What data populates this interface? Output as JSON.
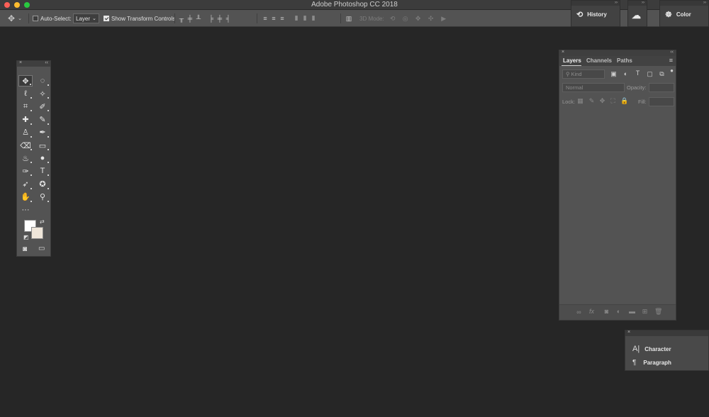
{
  "app": {
    "title": "Adobe Photoshop CC 2018"
  },
  "window": {
    "close_color": "#fd5f57",
    "minimize_color": "#febc2e",
    "zoom_color": "#29c840"
  },
  "options": {
    "move_icon": "move-tool-icon",
    "auto_select_label": "Auto-Select:",
    "auto_select_checked": false,
    "layer_select_value": "Layer",
    "show_transform_label": "Show Transform Controls",
    "show_transform_checked": true,
    "mode_3d_label": "3D Mode:"
  },
  "collapsed_panels": {
    "history": {
      "label": "History",
      "icon": "history-icon"
    },
    "libraries": {
      "icon": "creative-cloud-libraries-icon"
    },
    "color": {
      "label": "Color",
      "icon": "color-palette-icon"
    }
  },
  "tools": [
    {
      "name": "move-tool",
      "glyph": "✥",
      "active": true
    },
    {
      "name": "marquee-tool",
      "glyph": "◌"
    },
    {
      "name": "lasso-tool",
      "glyph": "ℓ"
    },
    {
      "name": "magic-wand-tool",
      "glyph": "✧"
    },
    {
      "name": "crop-tool",
      "glyph": "⌗"
    },
    {
      "name": "eyedropper-tool",
      "glyph": "✐"
    },
    {
      "name": "healing-brush-tool",
      "glyph": "✚"
    },
    {
      "name": "brush-tool",
      "glyph": "✎"
    },
    {
      "name": "clone-stamp-tool",
      "glyph": "♙"
    },
    {
      "name": "history-brush-tool",
      "glyph": "✒"
    },
    {
      "name": "eraser-tool",
      "glyph": "⌫"
    },
    {
      "name": "gradient-tool",
      "glyph": "▭"
    },
    {
      "name": "blur-tool",
      "glyph": "♨"
    },
    {
      "name": "dodge-tool",
      "glyph": "●"
    },
    {
      "name": "pen-tool",
      "glyph": "✑"
    },
    {
      "name": "type-tool",
      "glyph": "T"
    },
    {
      "name": "path-selection-tool",
      "glyph": "➶"
    },
    {
      "name": "custom-shape-tool",
      "glyph": "✪"
    },
    {
      "name": "hand-tool",
      "glyph": "✋"
    },
    {
      "name": "zoom-tool",
      "glyph": "⚲"
    },
    {
      "name": "edit-toolbar",
      "glyph": "···"
    }
  ],
  "colors": {
    "foreground": "#ffffff",
    "background": "#efe6da"
  },
  "layers_panel": {
    "tabs": [
      "Layers",
      "Channels",
      "Paths"
    ],
    "active_tab": "Layers",
    "kind_placeholder": "Kind",
    "blend_mode": "Normal",
    "opacity_label": "Opacity:",
    "lock_label": "Lock:",
    "fill_label": "Fill:",
    "footer_icons": [
      "link-layers-icon",
      "layer-style-icon",
      "layer-mask-icon",
      "adjustment-layer-icon",
      "new-group-icon",
      "new-layer-icon",
      "delete-layer-icon"
    ],
    "fx_label": "fx"
  },
  "type_panels": {
    "character": {
      "label": "Character",
      "icon": "character-icon"
    },
    "paragraph": {
      "label": "Paragraph",
      "icon": "paragraph-icon"
    }
  }
}
